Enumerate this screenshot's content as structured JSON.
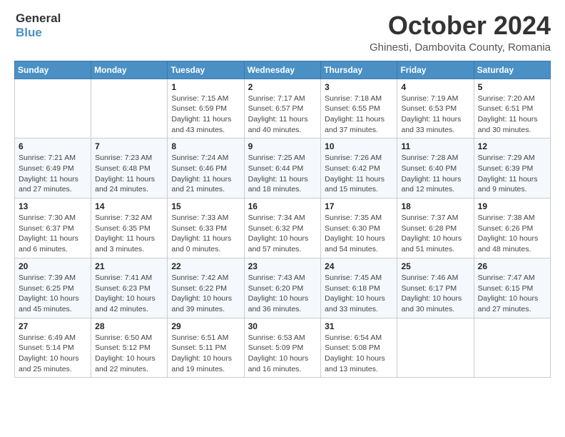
{
  "header": {
    "logo_general": "General",
    "logo_blue": "Blue",
    "month": "October 2024",
    "location": "Ghinesti, Dambovita County, Romania"
  },
  "weekdays": [
    "Sunday",
    "Monday",
    "Tuesday",
    "Wednesday",
    "Thursday",
    "Friday",
    "Saturday"
  ],
  "weeks": [
    [
      {
        "day": "",
        "info": ""
      },
      {
        "day": "",
        "info": ""
      },
      {
        "day": "1",
        "info": "Sunrise: 7:15 AM\nSunset: 6:59 PM\nDaylight: 11 hours and 43 minutes."
      },
      {
        "day": "2",
        "info": "Sunrise: 7:17 AM\nSunset: 6:57 PM\nDaylight: 11 hours and 40 minutes."
      },
      {
        "day": "3",
        "info": "Sunrise: 7:18 AM\nSunset: 6:55 PM\nDaylight: 11 hours and 37 minutes."
      },
      {
        "day": "4",
        "info": "Sunrise: 7:19 AM\nSunset: 6:53 PM\nDaylight: 11 hours and 33 minutes."
      },
      {
        "day": "5",
        "info": "Sunrise: 7:20 AM\nSunset: 6:51 PM\nDaylight: 11 hours and 30 minutes."
      }
    ],
    [
      {
        "day": "6",
        "info": "Sunrise: 7:21 AM\nSunset: 6:49 PM\nDaylight: 11 hours and 27 minutes."
      },
      {
        "day": "7",
        "info": "Sunrise: 7:23 AM\nSunset: 6:48 PM\nDaylight: 11 hours and 24 minutes."
      },
      {
        "day": "8",
        "info": "Sunrise: 7:24 AM\nSunset: 6:46 PM\nDaylight: 11 hours and 21 minutes."
      },
      {
        "day": "9",
        "info": "Sunrise: 7:25 AM\nSunset: 6:44 PM\nDaylight: 11 hours and 18 minutes."
      },
      {
        "day": "10",
        "info": "Sunrise: 7:26 AM\nSunset: 6:42 PM\nDaylight: 11 hours and 15 minutes."
      },
      {
        "day": "11",
        "info": "Sunrise: 7:28 AM\nSunset: 6:40 PM\nDaylight: 11 hours and 12 minutes."
      },
      {
        "day": "12",
        "info": "Sunrise: 7:29 AM\nSunset: 6:39 PM\nDaylight: 11 hours and 9 minutes."
      }
    ],
    [
      {
        "day": "13",
        "info": "Sunrise: 7:30 AM\nSunset: 6:37 PM\nDaylight: 11 hours and 6 minutes."
      },
      {
        "day": "14",
        "info": "Sunrise: 7:32 AM\nSunset: 6:35 PM\nDaylight: 11 hours and 3 minutes."
      },
      {
        "day": "15",
        "info": "Sunrise: 7:33 AM\nSunset: 6:33 PM\nDaylight: 11 hours and 0 minutes."
      },
      {
        "day": "16",
        "info": "Sunrise: 7:34 AM\nSunset: 6:32 PM\nDaylight: 10 hours and 57 minutes."
      },
      {
        "day": "17",
        "info": "Sunrise: 7:35 AM\nSunset: 6:30 PM\nDaylight: 10 hours and 54 minutes."
      },
      {
        "day": "18",
        "info": "Sunrise: 7:37 AM\nSunset: 6:28 PM\nDaylight: 10 hours and 51 minutes."
      },
      {
        "day": "19",
        "info": "Sunrise: 7:38 AM\nSunset: 6:26 PM\nDaylight: 10 hours and 48 minutes."
      }
    ],
    [
      {
        "day": "20",
        "info": "Sunrise: 7:39 AM\nSunset: 6:25 PM\nDaylight: 10 hours and 45 minutes."
      },
      {
        "day": "21",
        "info": "Sunrise: 7:41 AM\nSunset: 6:23 PM\nDaylight: 10 hours and 42 minutes."
      },
      {
        "day": "22",
        "info": "Sunrise: 7:42 AM\nSunset: 6:22 PM\nDaylight: 10 hours and 39 minutes."
      },
      {
        "day": "23",
        "info": "Sunrise: 7:43 AM\nSunset: 6:20 PM\nDaylight: 10 hours and 36 minutes."
      },
      {
        "day": "24",
        "info": "Sunrise: 7:45 AM\nSunset: 6:18 PM\nDaylight: 10 hours and 33 minutes."
      },
      {
        "day": "25",
        "info": "Sunrise: 7:46 AM\nSunset: 6:17 PM\nDaylight: 10 hours and 30 minutes."
      },
      {
        "day": "26",
        "info": "Sunrise: 7:47 AM\nSunset: 6:15 PM\nDaylight: 10 hours and 27 minutes."
      }
    ],
    [
      {
        "day": "27",
        "info": "Sunrise: 6:49 AM\nSunset: 5:14 PM\nDaylight: 10 hours and 25 minutes."
      },
      {
        "day": "28",
        "info": "Sunrise: 6:50 AM\nSunset: 5:12 PM\nDaylight: 10 hours and 22 minutes."
      },
      {
        "day": "29",
        "info": "Sunrise: 6:51 AM\nSunset: 5:11 PM\nDaylight: 10 hours and 19 minutes."
      },
      {
        "day": "30",
        "info": "Sunrise: 6:53 AM\nSunset: 5:09 PM\nDaylight: 10 hours and 16 minutes."
      },
      {
        "day": "31",
        "info": "Sunrise: 6:54 AM\nSunset: 5:08 PM\nDaylight: 10 hours and 13 minutes."
      },
      {
        "day": "",
        "info": ""
      },
      {
        "day": "",
        "info": ""
      }
    ]
  ]
}
